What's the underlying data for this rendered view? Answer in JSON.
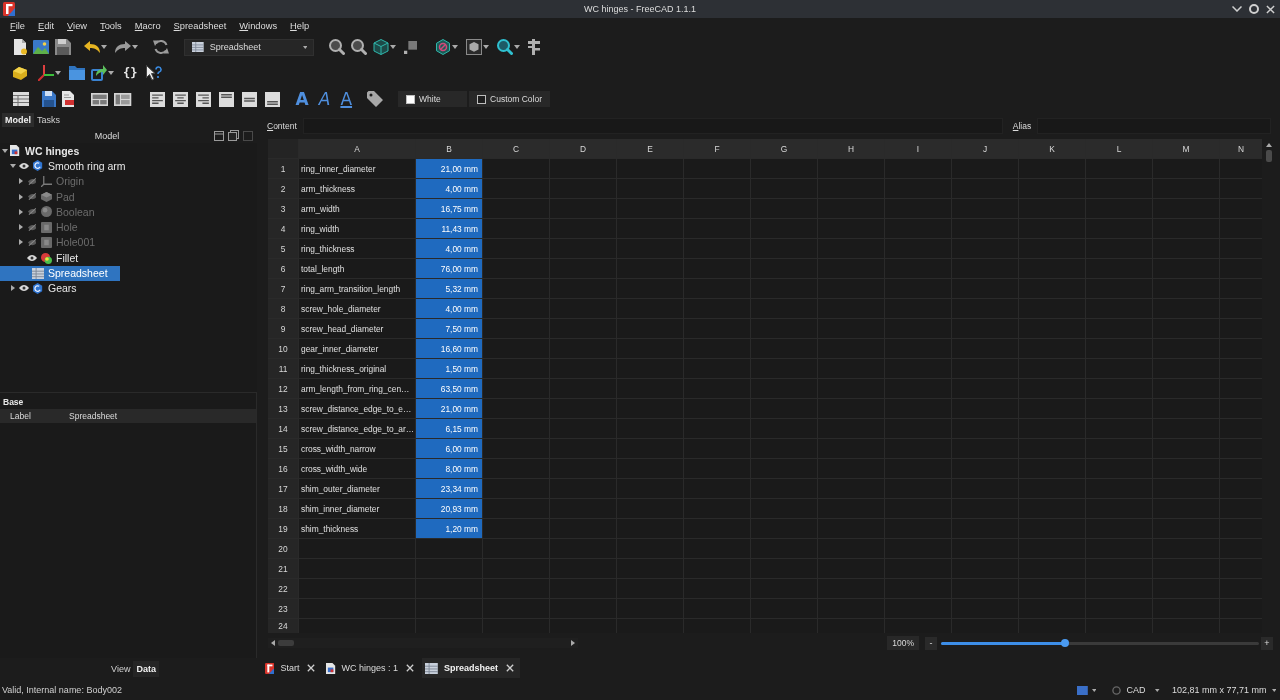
{
  "window": {
    "title": "WC hinges - FreeCAD 1.1.1"
  },
  "menu": [
    "File",
    "Edit",
    "View",
    "Tools",
    "Macro",
    "Spreadsheet",
    "Windows",
    "Help"
  ],
  "toolbar": {
    "workbench": "Spreadsheet",
    "expression_button": "{}",
    "text_style_buttons": [
      {
        "label": "A",
        "kind": "bold"
      },
      {
        "label": "A",
        "kind": "italic"
      },
      {
        "label": "A",
        "kind": "underline"
      }
    ],
    "color_buttons": [
      {
        "label": "White",
        "color": "#ffffff"
      },
      {
        "label": "Custom Color",
        "color": "#1e1e1e"
      }
    ]
  },
  "left_panel": {
    "tabs": [
      {
        "label": "Model",
        "selected": true
      },
      {
        "label": "Tasks",
        "selected": false
      }
    ],
    "title": "Model",
    "tree": [
      {
        "label": "WC hinges",
        "kind": "document",
        "expanded": true,
        "selected": false,
        "children": [
          {
            "label": "Smooth ring arm",
            "kind": "body",
            "expanded": true,
            "visible": true,
            "selected": false,
            "children": [
              {
                "label": "Origin",
                "kind": "origin",
                "expanded": false,
                "visible": false,
                "selected": false
              },
              {
                "label": "Pad",
                "kind": "pad",
                "expanded": false,
                "visible": false,
                "selected": false
              },
              {
                "label": "Boolean",
                "kind": "boolean",
                "expanded": false,
                "visible": false,
                "selected": false
              },
              {
                "label": "Hole",
                "kind": "hole",
                "expanded": false,
                "visible": false,
                "selected": false
              },
              {
                "label": "Hole001",
                "kind": "hole",
                "expanded": false,
                "visible": false,
                "selected": false
              },
              {
                "label": "Fillet",
                "kind": "fillet",
                "visible": true,
                "selected": false
              }
            ]
          },
          {
            "label": "Spreadsheet",
            "kind": "spreadsheet",
            "selected": true
          },
          {
            "label": "Gears",
            "kind": "body",
            "expanded": false,
            "visible": true,
            "selected": false
          }
        ]
      }
    ],
    "properties": [
      {
        "group": "Base",
        "rows": [
          {
            "name": "Label",
            "value": "Spreadsheet"
          }
        ]
      }
    ],
    "property_tabs": [
      {
        "label": "View",
        "selected": false
      },
      {
        "label": "Data",
        "selected": true
      }
    ]
  },
  "spreadsheet": {
    "content_label": "Content",
    "alias_label": "Alias",
    "columns": [
      "A",
      "B",
      "C",
      "D",
      "E",
      "F",
      "G",
      "H",
      "I",
      "J",
      "K",
      "L",
      "M",
      "N"
    ],
    "rows": [
      {
        "header": "1",
        "cells": [
          {
            "text": "ring_inner_diameter",
            "selected": false
          },
          {
            "text": "21,00 mm",
            "selected": true
          }
        ]
      },
      {
        "header": "2",
        "cells": [
          {
            "text": "arm_thickness",
            "selected": false
          },
          {
            "text": "4,00 mm",
            "selected": true
          }
        ]
      },
      {
        "header": "3",
        "cells": [
          {
            "text": "arm_width",
            "selected": false
          },
          {
            "text": "16,75 mm",
            "selected": true
          }
        ]
      },
      {
        "header": "4",
        "cells": [
          {
            "text": "ring_width",
            "selected": false
          },
          {
            "text": "11,43 mm",
            "selected": true
          }
        ]
      },
      {
        "header": "5",
        "cells": [
          {
            "text": "ring_thickness",
            "selected": false
          },
          {
            "text": "4,00 mm",
            "selected": true
          }
        ]
      },
      {
        "header": "6",
        "cells": [
          {
            "text": "total_length",
            "selected": false
          },
          {
            "text": "76,00 mm",
            "selected": true
          }
        ]
      },
      {
        "header": "7",
        "cells": [
          {
            "text": "ring_arm_transition_length",
            "selected": false
          },
          {
            "text": "5,32 mm",
            "selected": true
          }
        ]
      },
      {
        "header": "8",
        "cells": [
          {
            "text": "screw_hole_diameter",
            "selected": false
          },
          {
            "text": "4,00 mm",
            "selected": true
          }
        ]
      },
      {
        "header": "9",
        "cells": [
          {
            "text": "screw_head_diameter",
            "selected": false
          },
          {
            "text": "7,50 mm",
            "selected": true
          }
        ]
      },
      {
        "header": "10",
        "cells": [
          {
            "text": "gear_inner_diameter",
            "selected": false
          },
          {
            "text": "16,60 mm",
            "selected": true
          }
        ]
      },
      {
        "header": "11",
        "cells": [
          {
            "text": "ring_thickness_original",
            "selected": false
          },
          {
            "text": "1,50 mm",
            "selected": true
          }
        ]
      },
      {
        "header": "12",
        "cells": [
          {
            "text": "arm_length_from_ring_cen…",
            "selected": false
          },
          {
            "text": "63,50 mm",
            "selected": true
          }
        ]
      },
      {
        "header": "13",
        "cells": [
          {
            "text": "screw_distance_edge_to_e…",
            "selected": false
          },
          {
            "text": "21,00 mm",
            "selected": true
          }
        ]
      },
      {
        "header": "14",
        "cells": [
          {
            "text": "screw_distance_edge_to_ar…",
            "selected": false
          },
          {
            "text": "6,15 mm",
            "selected": true
          }
        ]
      },
      {
        "header": "15",
        "cells": [
          {
            "text": "cross_width_narrow",
            "selected": false
          },
          {
            "text": "6,00 mm",
            "selected": true
          }
        ]
      },
      {
        "header": "16",
        "cells": [
          {
            "text": "cross_width_wide",
            "selected": false
          },
          {
            "text": "8,00 mm",
            "selected": true
          }
        ]
      },
      {
        "header": "17",
        "cells": [
          {
            "text": "shim_outer_diameter",
            "selected": false
          },
          {
            "text": "23,34 mm",
            "selected": true
          }
        ]
      },
      {
        "header": "18",
        "cells": [
          {
            "text": "shim_inner_diameter",
            "selected": false
          },
          {
            "text": "20,93 mm",
            "selected": true
          }
        ]
      },
      {
        "header": "19",
        "cells": [
          {
            "text": "shim_thickness",
            "selected": false
          },
          {
            "text": "1,20 mm",
            "selected": true
          }
        ]
      },
      {
        "header": "20"
      },
      {
        "header": "21"
      },
      {
        "header": "22"
      },
      {
        "header": "23"
      },
      {
        "header": "24"
      }
    ],
    "zoom": {
      "reading": "100%",
      "minus": "-",
      "plus": "+",
      "level": 0.39
    }
  },
  "document_tabs": [
    {
      "label": "Start",
      "kind": "start",
      "selected": false
    },
    {
      "label": "WC hinges : 1",
      "kind": "document",
      "selected": false
    },
    {
      "label": "Spreadsheet",
      "kind": "spreadsheet",
      "selected": true
    }
  ],
  "status_bar": {
    "message": "Valid, Internal name: Body002",
    "navigation_style": "CAD",
    "dimensions": "102,81 mm x 77,71 mm"
  }
}
